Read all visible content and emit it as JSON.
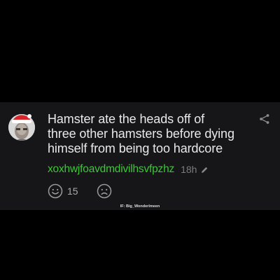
{
  "comment": {
    "text_lines": [
      "Hamster ate the heads off of",
      "three other hamsters before dying",
      "himself from being too hardcore"
    ],
    "username": "xoxhwjfoavdmdivilhsvfpzhz",
    "timestamp": "18h",
    "like_count": "15"
  },
  "icons": {
    "avatar": "santa-hat-avatar",
    "share": "share-icon",
    "edit": "pencil-icon",
    "like": "smile-icon",
    "dislike": "frown-icon"
  },
  "colors": {
    "background": "#000000",
    "card": "#161618",
    "text": "#e9e9e9",
    "username": "#3fc43c",
    "muted": "#7c7c7c"
  },
  "watermark": "IF: Big_Wonderlmeen"
}
